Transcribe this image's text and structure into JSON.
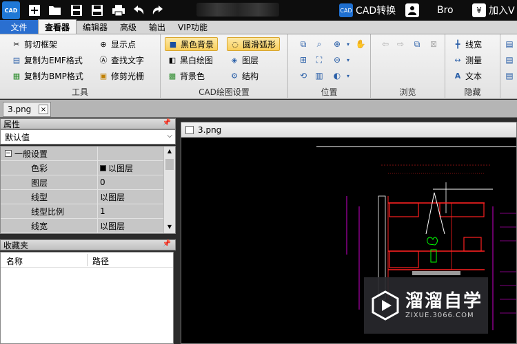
{
  "titlebar": {
    "app_logo_text": "CAD",
    "cad_convert_label": "CAD转换",
    "user_name": "Bro",
    "join_vip_label": "加入V"
  },
  "menu": {
    "file": "文件",
    "viewer": "查看器",
    "editor": "编辑器",
    "advanced": "高级",
    "output": "输出",
    "vip": "VIP功能"
  },
  "ribbon": {
    "tools": {
      "label": "工具",
      "clip_frame": "剪切框架",
      "copy_emf": "复制为EMF格式",
      "copy_bmp": "复制为BMP格式",
      "show_points": "显示点",
      "find_text": "查找文字",
      "trim_raster": "修剪光栅"
    },
    "draw_settings": {
      "label": "CAD绘图设置",
      "black_bg": "黑色背景",
      "bw_draw": "黑白绘图",
      "bg_color": "背景色",
      "smooth_arc": "圆滑弧形",
      "layers": "图层",
      "structure": "结构"
    },
    "position": {
      "label": "位置"
    },
    "browse": {
      "label": "浏览"
    },
    "hide": {
      "label": "隐藏",
      "line_width": "线宽",
      "measure": "测量",
      "text": "文本"
    }
  },
  "doc_tab": {
    "name": "3.png",
    "close": "×"
  },
  "properties_panel": {
    "title": "属性",
    "selector": "默认值",
    "section": "一般设置",
    "rows": [
      {
        "key": "色彩",
        "value": "以图层",
        "swatch": "#000000"
      },
      {
        "key": "图层",
        "value": "0"
      },
      {
        "key": "线型",
        "value": "以图层"
      },
      {
        "key": "线型比例",
        "value": "1"
      },
      {
        "key": "线宽",
        "value": "以图层"
      }
    ]
  },
  "favorites_panel": {
    "title": "收藏夹",
    "col_name": "名称",
    "col_path": "路径"
  },
  "viewer": {
    "file_name": "3.png"
  },
  "watermark": {
    "title": "溜溜自学",
    "url": "ZIXUE.3066.COM"
  },
  "colors": {
    "menu_file_bg": "#2a6fd0",
    "selected_btn": "#f9cf5c",
    "cad_red": "#ff2020",
    "cad_magenta": "#ff00ff",
    "cad_green": "#00ff00"
  }
}
